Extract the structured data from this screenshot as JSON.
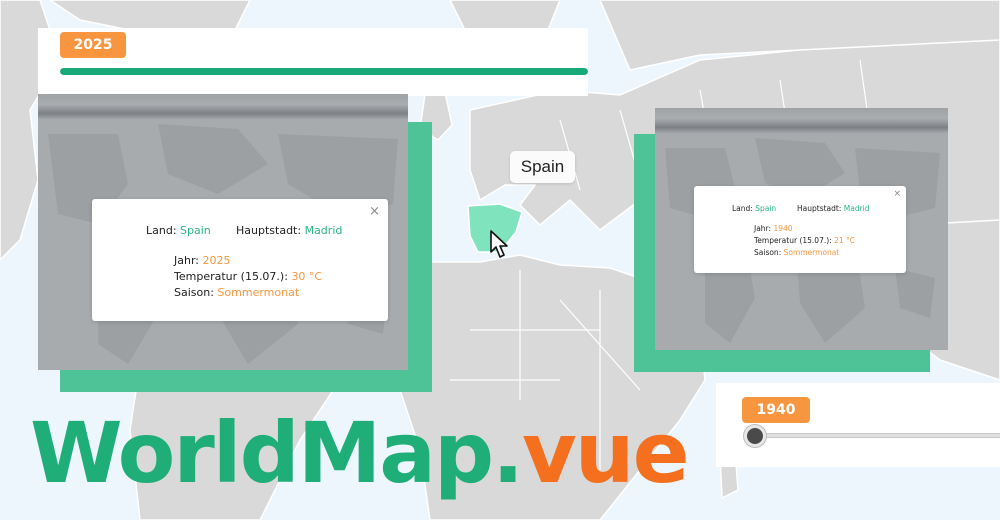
{
  "colors": {
    "accent_green": "#1fae78",
    "accent_orange": "#f7963f",
    "land": "#d8d8d8",
    "ocean": "#eef6fd",
    "highlight_country": "#7fe3bd"
  },
  "top_slider": {
    "year": "2025",
    "progress": 1.0
  },
  "bottom_slider": {
    "year": "1940",
    "progress": 0.0
  },
  "tooltip": {
    "country": "Spain"
  },
  "card_left": {
    "land_label": "Land:",
    "land_value": "Spain",
    "capital_label": "Hauptstadt:",
    "capital_value": "Madrid",
    "year_label": "Jahr:",
    "year_value": "2025",
    "temp_label": "Temperatur (15.07.):",
    "temp_value": "30 °C",
    "season_label": "Saison:",
    "season_value": "Sommermonat",
    "close_icon": "×"
  },
  "card_right": {
    "land_label": "Land:",
    "land_value": "Spain",
    "capital_label": "Hauptstadt:",
    "capital_value": "Madrid",
    "year_label": "Jahr:",
    "year_value": "1940",
    "temp_label": "Temperatur (15.07.):",
    "temp_value": "21 °C",
    "season_label": "Saison:",
    "season_value": "Sommermonat",
    "close_icon": "×"
  },
  "logo": {
    "part1": "WorldMap.",
    "part2": "vue"
  },
  "icons": {
    "cursor": "mouse-pointer-icon",
    "close": "close-icon"
  }
}
